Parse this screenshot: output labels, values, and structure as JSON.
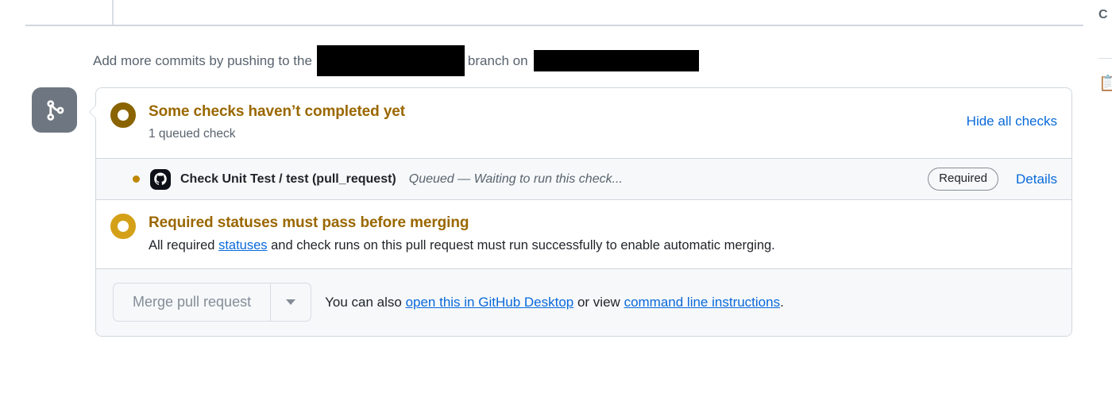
{
  "timeline": {
    "push_prefix": "Add more commits by pushing to the",
    "push_middle": "branch on",
    "branch_redacted": "",
    "repo_redacted": "",
    "avatar_icon": "git-merge-icon"
  },
  "checks_box": {
    "header": {
      "title": "Some checks haven’t completed yet",
      "subtitle": "1 queued check",
      "hide_all_label": "Hide all checks",
      "status_icon": "pending-circle-icon",
      "status_color": "#8a6400"
    },
    "checks": [
      {
        "dot_color": "#bf8700",
        "avatar_icon": "github-mark-icon",
        "name": "Check Unit Test / test (pull_request)",
        "description": "Queued — Waiting to run this check...",
        "badge": "Required",
        "details_label": "Details"
      }
    ],
    "required_statuses": {
      "title": "Required statuses must pass before merging",
      "status_icon": "pending-circle-icon",
      "status_color": "#d4a017",
      "desc_before": "All required",
      "desc_link": "statuses",
      "desc_after": "and check runs on this pull request must run successfully to enable automatic merging."
    },
    "footer": {
      "merge_button_label": "Merge pull request",
      "merge_caret_icon": "chevron-down-icon",
      "text_before": "You can also",
      "link_desktop": "open this in GitHub Desktop",
      "text_middle": "or view",
      "link_cli": "command line instructions",
      "text_after": "."
    }
  },
  "right_sidebar": {
    "label": "C",
    "icon": "clipboard-icon"
  }
}
